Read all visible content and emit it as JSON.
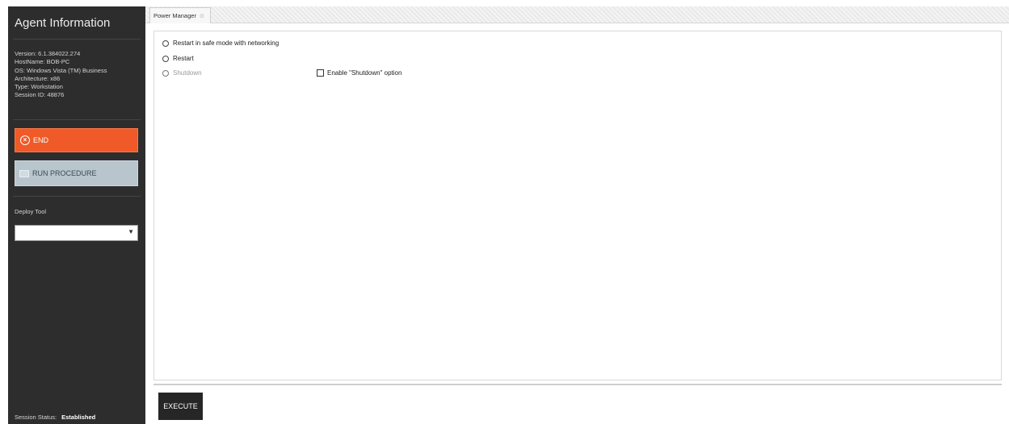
{
  "sidebar": {
    "title": "Agent Information",
    "info": {
      "version": "Version: 6.1.384022.274",
      "hostname": "HostName: BOB-PC",
      "os": "OS: Windows Vista (TM) Business",
      "architecture": "Architecture: x86",
      "type": "Type: Workstation",
      "session_id": "Session ID: 48876"
    },
    "end_label": "END",
    "run_label": "RUN PROCEDURE",
    "deploy_label": "Deploy Tool",
    "deploy_selected": "",
    "session_status_label": "Session Status:",
    "session_status_value": "Established"
  },
  "tabs": [
    {
      "label": "Power Manager",
      "icon": "close-icon"
    }
  ],
  "options": {
    "restart_safe": "Restart in safe mode with networking",
    "restart": "Restart",
    "shutdown": "Shutdown",
    "enable_shutdown": "Enable \"Shutdown\" option"
  },
  "footer": {
    "execute_label": "EXECUTE"
  },
  "colors": {
    "sidebar_bg": "#2d2d2d",
    "end_button": "#f05a28",
    "run_button": "#b8c5cc",
    "execute_button": "#262626"
  }
}
